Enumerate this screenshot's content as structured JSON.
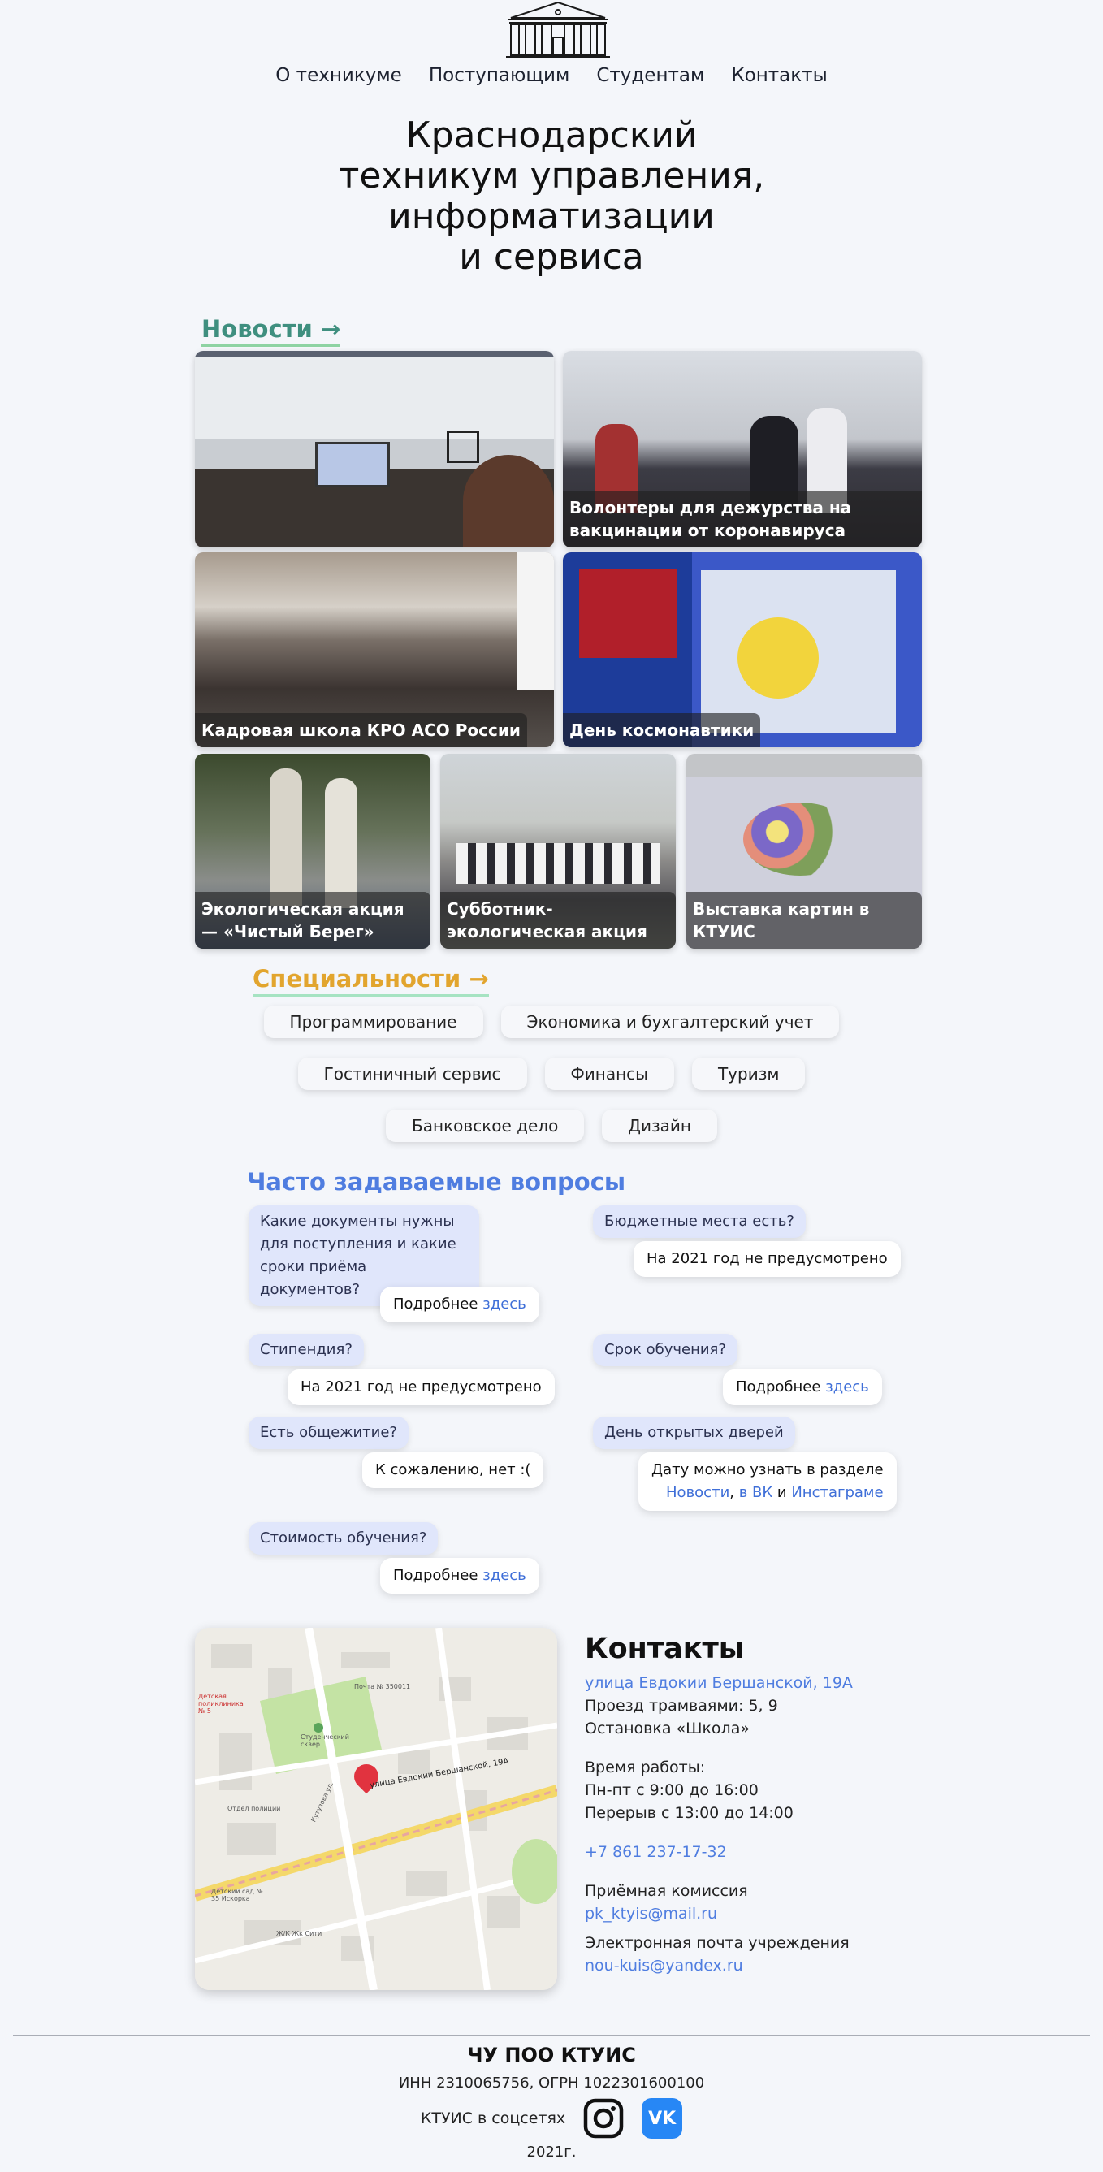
{
  "nav": [
    "О техникуме",
    "Поступающим",
    "Студентам",
    "Контакты"
  ],
  "title": [
    "Краснодарский",
    "техникум управления,",
    "информатизации",
    "и сервиса"
  ],
  "news": {
    "heading": "Новости →",
    "items": [
      {
        "caption": ""
      },
      {
        "caption": "Волонтеры для дежурства на вакцинации от коронавируса"
      },
      {
        "caption": "Кадровая школа КРО АСО России"
      },
      {
        "caption": "День космонавтики"
      },
      {
        "caption": "Экологическая акция — «Чистый Берег»"
      },
      {
        "caption": "Субботник-экологическая акция"
      },
      {
        "caption": "Выставка картин в КТУИС"
      }
    ]
  },
  "specialities": {
    "heading": "Специальности →",
    "rows": [
      [
        "Программирование",
        "Экономика и бухгалтерский учет"
      ],
      [
        "Гостиничный сервис",
        "Финансы",
        "Туризм"
      ],
      [
        "Банковское дело",
        "Дизайн"
      ]
    ]
  },
  "faq": {
    "heading": "Часто задаваемые вопросы",
    "q1": "Какие документы нужны для поступления и какие сроки приёма документов?",
    "a1_text": "Подробнее ",
    "a1_link": "здесь",
    "q2": "Бюджетные места есть?",
    "a2": "На 2021 год не предусмотрено",
    "q3": "Стипендия?",
    "a3": "На 2021 год не предусмотрено",
    "q4": "Срок обучения?",
    "a4_text": "Подробнее ",
    "a4_link": "здесь",
    "q5": "Есть общежитие?",
    "a5": "К сожалению, нет :(",
    "q6": "День открытых дверей",
    "a6_text": "Дату можно узнать в разделе",
    "a6_link1": "Новости",
    "a6_sep": ", ",
    "a6_link2": "в ВК",
    "a6_and": " и ",
    "a6_link3": "Инстаграме",
    "q7": "Стоимость обучения?",
    "a7_text": "Подробнее ",
    "a7_link": "здесь"
  },
  "map": {
    "address_label": "улица Евдокии Бершанской, 19А",
    "labels": [
      "Детская поликлиника № 5",
      "Студенческий сквер",
      "Кутузова ул.",
      "Отдел полиции",
      "Почта № 350011",
      "Детский сад № 35 Искорка",
      "Ж/К Жк Сити"
    ]
  },
  "contacts": {
    "heading": "Контакты",
    "address": "улица Евдокии Бершанской, 19А",
    "tram": "Проезд трамваями: 5, 9",
    "stop": "Остановка «Школа»",
    "hours_title": "Время работы:",
    "hours": "Пн-пт с 9:00 до 16:00",
    "break": "Перерыв с 13:00 до 14:00",
    "phone": "+7 861 237-17-32",
    "admission_title": "Приёмная комиссия",
    "admission_email": "pk_ktyis@mail.ru",
    "mail_title": "Электронная почта учреждения",
    "mail": "nou-kuis@yandex.ru"
  },
  "footer": {
    "org": "ЧУ ПОО КТУИС",
    "inn": "ИНН 2310065756, ОГРН 1022301600100",
    "social_label": "КТУИС в соцсетях",
    "vk_label": "VK",
    "year": "2021г."
  },
  "colors": {
    "news_heading": "#3f8f7f",
    "spec_heading": "#e2a52e",
    "faq_heading": "#4f7de0",
    "link": "#3f6fd8",
    "question_bg": "#e0e6fb",
    "vk": "#2787f5"
  },
  "icons": [
    "building-logo-icon",
    "instagram-icon",
    "vk-icon",
    "map-pin-icon"
  ]
}
